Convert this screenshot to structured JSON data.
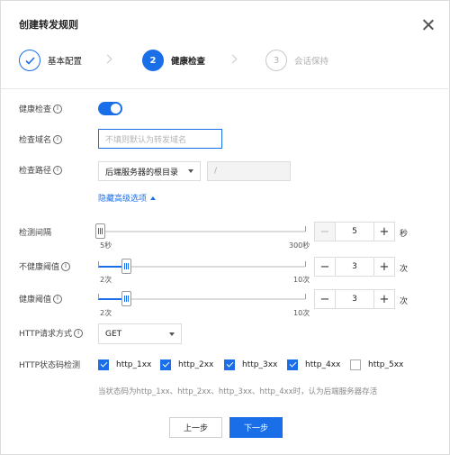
{
  "dialog": {
    "title": "创建转发规则"
  },
  "steps": [
    {
      "label": "基本配置",
      "state": "done",
      "icon": "check-icon"
    },
    {
      "number": "2",
      "label": "健康检查",
      "state": "active"
    },
    {
      "number": "3",
      "label": "会话保持",
      "state": "todo"
    }
  ],
  "form": {
    "health_check": {
      "label": "健康检查",
      "enabled": true
    },
    "check_domain": {
      "label": "检查域名",
      "placeholder": "不填则默认为转发域名"
    },
    "check_path": {
      "label": "检查路径",
      "select_value": "后端服务器的根目录",
      "path_value": "/"
    },
    "advanced_link": "隐藏高级选项",
    "interval": {
      "label": "检测间隔",
      "min_label": "5秒",
      "max_label": "300秒",
      "value": "5",
      "unit": "秒",
      "level": 0.0
    },
    "unhealthy_threshold": {
      "label": "不健康阈值",
      "min_label": "2次",
      "max_label": "10次",
      "value": "3",
      "unit": "次",
      "level": 0.125
    },
    "healthy_threshold": {
      "label": "健康阈值",
      "min_label": "2次",
      "max_label": "10次",
      "value": "3",
      "unit": "次",
      "level": 0.125
    },
    "http_method": {
      "label": "HTTP请求方式",
      "value": "GET"
    },
    "http_status": {
      "label": "HTTP状态码检测",
      "options": [
        {
          "label": "http_1xx",
          "checked": true
        },
        {
          "label": "http_2xx",
          "checked": true
        },
        {
          "label": "http_3xx",
          "checked": true
        },
        {
          "label": "http_4xx",
          "checked": true
        },
        {
          "label": "http_5xx",
          "checked": false
        }
      ],
      "hint": "当状态码为http_1xx、http_2xx、http_3xx、http_4xx时，认为后端服务器存活"
    }
  },
  "footer": {
    "prev_label": "上一步",
    "next_label": "下一步"
  },
  "colors": {
    "accent": "#1a6ee8",
    "border": "#dcdcdc",
    "muted": "#b0b0b0"
  }
}
